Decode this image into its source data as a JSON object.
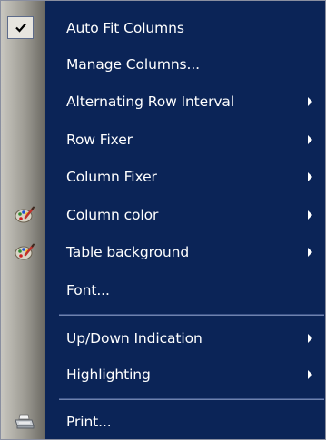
{
  "menu": {
    "items": [
      {
        "label": "Auto Fit Columns",
        "checked": true,
        "has_submenu": false,
        "icon": "checkmark-icon"
      },
      {
        "label": "Manage Columns...",
        "has_submenu": false
      },
      {
        "label": "Alternating Row Interval",
        "has_submenu": true
      },
      {
        "label": "Row Fixer",
        "has_submenu": true
      },
      {
        "label": "Column Fixer",
        "has_submenu": true
      },
      {
        "label": "Column color",
        "has_submenu": true,
        "icon": "paint-palette-icon"
      },
      {
        "label": "Table background",
        "has_submenu": true,
        "icon": "paint-palette-icon"
      },
      {
        "label": "Font...",
        "has_submenu": false
      },
      {
        "label": "Up/Down Indication",
        "has_submenu": true
      },
      {
        "label": "Highlighting",
        "has_submenu": true
      },
      {
        "label": "Print...",
        "has_submenu": false,
        "icon": "printer-icon"
      }
    ]
  },
  "colors": {
    "menu_background": "#0b2457",
    "text": "#ffffff",
    "gutter": "#9c9a92"
  }
}
